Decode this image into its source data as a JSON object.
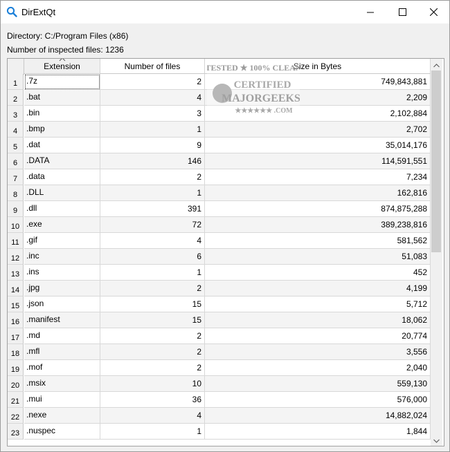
{
  "window": {
    "title": "DirExtQt",
    "icons": {
      "app": "search-icon",
      "minimize": "minimize-icon",
      "maximize": "maximize-icon",
      "close": "close-icon"
    }
  },
  "info": {
    "directory_line": "Directory: C:/Program Files (x86)",
    "inspected_line": "Number of inspected files: 1236"
  },
  "table": {
    "headers": {
      "extension": "Extension",
      "count": "Number of files",
      "size": "Size in Bytes"
    },
    "sorted_by": "extension",
    "rows": [
      {
        "num": "1",
        "ext": ".7z",
        "count": "2",
        "size": "749,843,881"
      },
      {
        "num": "2",
        "ext": ".bat",
        "count": "4",
        "size": "2,209"
      },
      {
        "num": "3",
        "ext": ".bin",
        "count": "3",
        "size": "2,102,884"
      },
      {
        "num": "4",
        "ext": ".bmp",
        "count": "1",
        "size": "2,702"
      },
      {
        "num": "5",
        "ext": ".dat",
        "count": "9",
        "size": "35,014,176"
      },
      {
        "num": "6",
        "ext": ".DATA",
        "count": "146",
        "size": "114,591,551"
      },
      {
        "num": "7",
        "ext": ".data",
        "count": "2",
        "size": "7,234"
      },
      {
        "num": "8",
        "ext": ".DLL",
        "count": "1",
        "size": "162,816"
      },
      {
        "num": "9",
        "ext": ".dll",
        "count": "391",
        "size": "874,875,288"
      },
      {
        "num": "10",
        "ext": ".exe",
        "count": "72",
        "size": "389,238,816"
      },
      {
        "num": "11",
        "ext": ".gif",
        "count": "4",
        "size": "581,562"
      },
      {
        "num": "12",
        "ext": ".inc",
        "count": "6",
        "size": "51,083"
      },
      {
        "num": "13",
        "ext": ".ins",
        "count": "1",
        "size": "452"
      },
      {
        "num": "14",
        "ext": ".jpg",
        "count": "2",
        "size": "4,199"
      },
      {
        "num": "15",
        "ext": ".json",
        "count": "15",
        "size": "5,712"
      },
      {
        "num": "16",
        "ext": ".manifest",
        "count": "15",
        "size": "18,062"
      },
      {
        "num": "17",
        "ext": ".md",
        "count": "2",
        "size": "20,774"
      },
      {
        "num": "18",
        "ext": ".mfl",
        "count": "2",
        "size": "3,556"
      },
      {
        "num": "19",
        "ext": ".mof",
        "count": "2",
        "size": "2,040"
      },
      {
        "num": "20",
        "ext": ".msix",
        "count": "10",
        "size": "559,130"
      },
      {
        "num": "21",
        "ext": ".mui",
        "count": "36",
        "size": "576,000"
      },
      {
        "num": "22",
        "ext": ".nexe",
        "count": "4",
        "size": "14,882,024"
      },
      {
        "num": "23",
        "ext": ".nuspec",
        "count": "1",
        "size": "1,844"
      }
    ]
  },
  "watermark": {
    "line1": "TESTED ★ 100% CLEAN",
    "line2": "CERTIFIED",
    "line3": "MAJORGEEKS",
    "line4": "★★★★★★ .COM"
  },
  "colors": {
    "accent": "#0078d7",
    "header_sorted_bg": "#f0f0f0",
    "alt_row": "#f4f4f4"
  }
}
